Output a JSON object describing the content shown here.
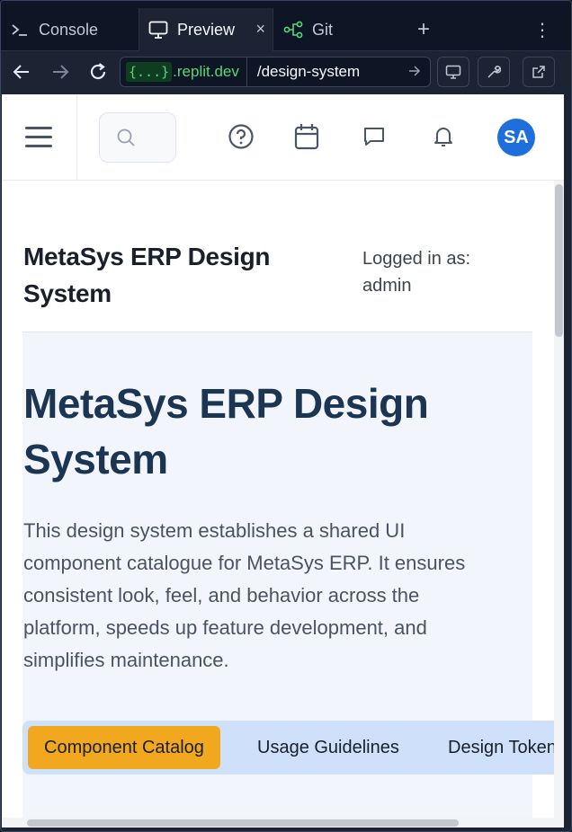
{
  "tabs": {
    "console": "Console",
    "preview": "Preview",
    "git": "Git",
    "add": "+",
    "more": "⋮",
    "close": "×"
  },
  "urlbar": {
    "domain_badge": "{...}",
    "domain_host": ".replit.dev",
    "path": "/design-system"
  },
  "header": {
    "avatar_initials": "SA"
  },
  "page": {
    "site_title": "MetaSys ERP Design System",
    "login_info": "Logged in as: admin",
    "hero_title": "MetaSys ERP Design System",
    "hero_description": "This design system establishes a shared UI component catalogue for MetaSys ERP. It ensures consistent look, feel, and behavior across the platform, speeds up feature development, and simplifies maintenance.",
    "section_tabs": [
      "Component Catalog",
      "Usage Guidelines",
      "Design Tokens"
    ]
  },
  "colors": {
    "accent_active_tab": "#f1a81e",
    "avatar": "#1e6fdc",
    "hero_title": "#1b3553",
    "domain_green": "#58d67a"
  },
  "icons": {
    "menu": "hamburger-icon",
    "search": "search-icon",
    "help": "help-circle-icon",
    "calendar": "calendar-icon",
    "messages": "message-icon",
    "notifications": "bell-icon"
  }
}
